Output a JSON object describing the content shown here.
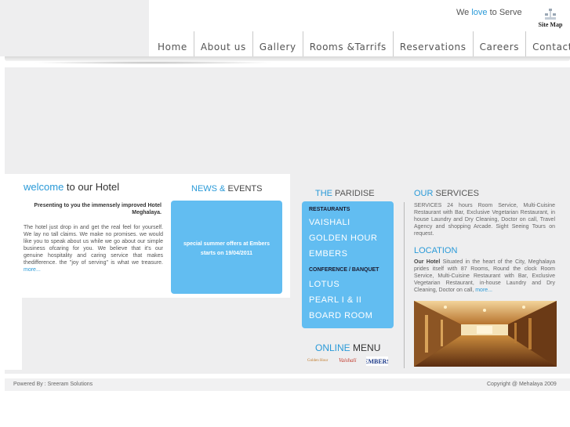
{
  "header": {
    "tagline_pre": "We ",
    "tagline_highlight": "love",
    "tagline_post": " to Serve",
    "sitemap_label": "Site Map"
  },
  "nav": {
    "items": [
      "Home",
      "About us",
      "Gallery",
      "Rooms &Tarrifs",
      "Reservations",
      "Careers",
      "Contact Us"
    ]
  },
  "welcome": {
    "title_highlight": "welcome",
    "title_rest": " to our Hotel",
    "subtitle": "Presenting to you the immensely improved Hotel Meghalaya.",
    "body": "The hotel just drop in and get the real feel for yourself. We lay no tall claims. We make no promises. we would like you to speak about us while we go about our simple business ofcaring for you. We believe that it's our genuine hospitality and caring service that makes thedifference. the \"joy of serving\" is what we treasure.",
    "more_label": "more..."
  },
  "news": {
    "title_highlight": "NEWS &",
    "title_rest": " EVENTS",
    "text": "special summer offers at Embers starts on 19/04/2011"
  },
  "paridise": {
    "title_highlight": "THE",
    "title_rest": " PARIDISE",
    "restaurants_heading": "RESTAURANTS",
    "restaurants": [
      "VAISHALI",
      "GOLDEN HOUR",
      "EMBERS"
    ],
    "conference_heading": "CONFERENCE / BANQUET",
    "conference": [
      "LOTUS",
      "PEARL I & II",
      "BOARD ROOM"
    ]
  },
  "online_menu": {
    "title_highlight": "ONLINE",
    "title_rest": " MENU",
    "logos": [
      "Golden Hour",
      "Vaishali",
      "EMBERS"
    ]
  },
  "services": {
    "title_highlight": "OUR",
    "title_rest": "  SERVICES",
    "body": "SERVICES 24 hours Room Service, Multi-Cuisine Restaurant with Bar, Exclusive Vegetarian Restaurant, in house Laundry and Dry Cleaning, Doctor on call, Travel Agency and shopping Arcade. Sight Seeing Tours on request."
  },
  "location": {
    "title": "LOCATION",
    "lead": "Our Hotel",
    "body": " Situated in the heart of the City, Meghalaya prides itself with 87 Rooms, Round the clock Room Service, Multi-Cuisine Restaurant with Bar, Exclusive Vegetarian Restaurant, in-house Laundry and Dry Cleaning, Doctor on call, ",
    "more_label": "more..."
  },
  "footer": {
    "powered": "Powered By : Sreeram Solutions",
    "copyright": "Copyright @ Mehalaya 2009"
  },
  "colors": {
    "accent": "#2a9ad8",
    "panel_blue": "#62bdf1",
    "stage_gray": "#eeeeef"
  }
}
